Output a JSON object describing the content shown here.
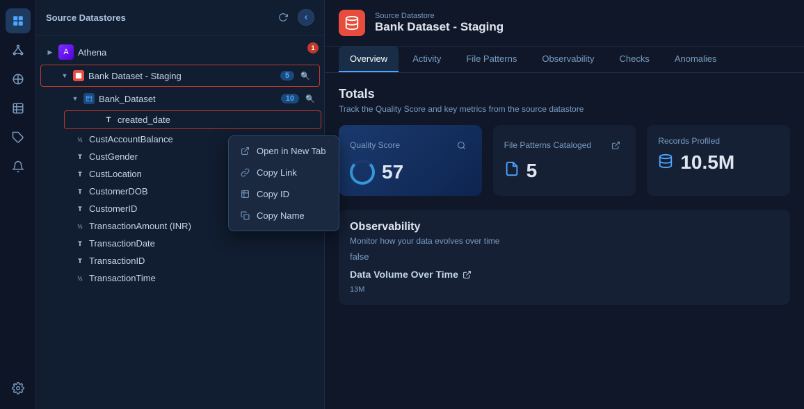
{
  "nav": {
    "icons": [
      "⬡",
      "⊞",
      "◎",
      "☑",
      "🏷",
      "🔔",
      "⚙"
    ]
  },
  "sidebar": {
    "title": "Source Datastores",
    "items": [
      {
        "id": "athena",
        "label": "Athena",
        "level": 1,
        "type": "athena",
        "expanded": true,
        "badge": "1",
        "selected": false
      },
      {
        "id": "bank-dataset-staging",
        "label": "Bank Dataset - Staging",
        "level": 2,
        "type": "dataset",
        "badge": "5",
        "selected": true,
        "expanded": true
      },
      {
        "id": "bank-dataset-table",
        "label": "Bank_Dataset",
        "level": 3,
        "type": "table",
        "badge": "10",
        "selected": false,
        "expanded": true
      }
    ],
    "columns": [
      {
        "id": "created_date",
        "label": "created_date",
        "type": "T",
        "selected": true
      },
      {
        "id": "cust-account-balance",
        "label": "CustAccountBalance",
        "type": "½"
      },
      {
        "id": "cust-gender",
        "label": "CustGender",
        "type": "T"
      },
      {
        "id": "cust-location",
        "label": "CustLocation",
        "type": "T"
      },
      {
        "id": "customer-dob",
        "label": "CustomerDOB",
        "type": "T"
      },
      {
        "id": "customer-id",
        "label": "CustomerID",
        "type": "T"
      },
      {
        "id": "transaction-amount",
        "label": "TransactionAmount (INR)",
        "type": "½"
      },
      {
        "id": "transaction-date",
        "label": "TransactionDate",
        "type": "T"
      },
      {
        "id": "transaction-id",
        "label": "TransactionID",
        "type": "T"
      },
      {
        "id": "transaction-time",
        "label": "TransactionTime",
        "type": "½"
      }
    ]
  },
  "context_menu": {
    "items": [
      {
        "id": "open-new-tab",
        "label": "Open in New Tab",
        "icon": "↗"
      },
      {
        "id": "copy-link",
        "label": "Copy Link",
        "icon": "🔗"
      },
      {
        "id": "copy-id",
        "label": "Copy ID",
        "icon": "⊞"
      },
      {
        "id": "copy-name",
        "label": "Copy Name",
        "icon": "⧉"
      }
    ]
  },
  "main": {
    "header": {
      "subtitle": "Source Datastore",
      "title": "Bank Dataset - Staging"
    },
    "tabs": [
      {
        "id": "overview",
        "label": "Overview",
        "active": true
      },
      {
        "id": "activity",
        "label": "Activity",
        "active": false
      },
      {
        "id": "file-patterns",
        "label": "File Patterns",
        "active": false
      },
      {
        "id": "observability",
        "label": "Observability",
        "active": false
      },
      {
        "id": "checks",
        "label": "Checks",
        "active": false
      },
      {
        "id": "anomalies",
        "label": "Anomalies",
        "active": false
      }
    ],
    "totals_title": "Totals",
    "totals_subtitle": "Track the Quality Score and key metrics from the source datastore",
    "metrics": [
      {
        "id": "quality-score",
        "label": "Quality Score",
        "value": "57",
        "type": "quality"
      },
      {
        "id": "file-patterns",
        "label": "File Patterns Cataloged",
        "value": "5",
        "icon": "📄"
      },
      {
        "id": "records-profiled",
        "label": "Records Profiled",
        "value": "10.5M",
        "icon": "🗄"
      }
    ],
    "observability": {
      "title": "Observability",
      "subtitle": "Monitor how your data evolves over time",
      "status": "false",
      "data_volume_title": "Data Volume Over Time",
      "chart_y_label": "13M"
    }
  }
}
